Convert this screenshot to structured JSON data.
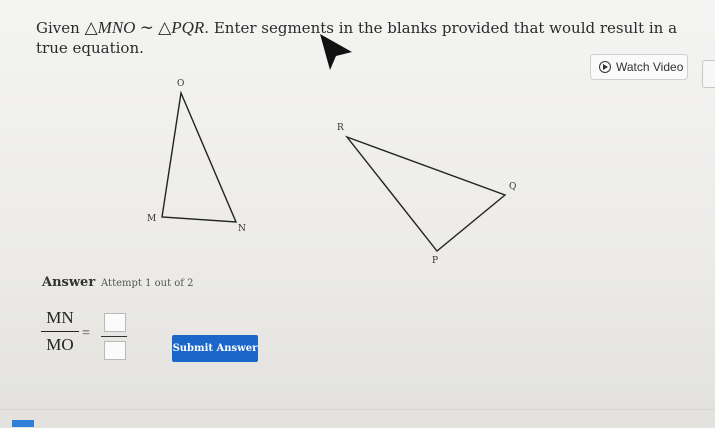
{
  "prompt": {
    "given": "Given",
    "similarity": "△MNO ∼ △PQR",
    "instruction": ". Enter segments in the blanks provided that would result in a true equation."
  },
  "watch_video": {
    "label": "Watch Video",
    "icon": "play-circle-icon"
  },
  "triangle_mno": {
    "vertices": [
      "O",
      "M",
      "N"
    ]
  },
  "triangle_pqr": {
    "vertices": [
      "R",
      "Q",
      "P"
    ]
  },
  "answer": {
    "label": "Answer",
    "attempt": "Attempt 1 out of 2",
    "numerator": "MN",
    "denominator": "MO",
    "equals": "=",
    "blank_top_value": "",
    "blank_bottom_value": ""
  },
  "submit": {
    "label": "Submit Answer"
  },
  "colors": {
    "accent": "#1b67c9",
    "background": "#eeeeeb"
  }
}
